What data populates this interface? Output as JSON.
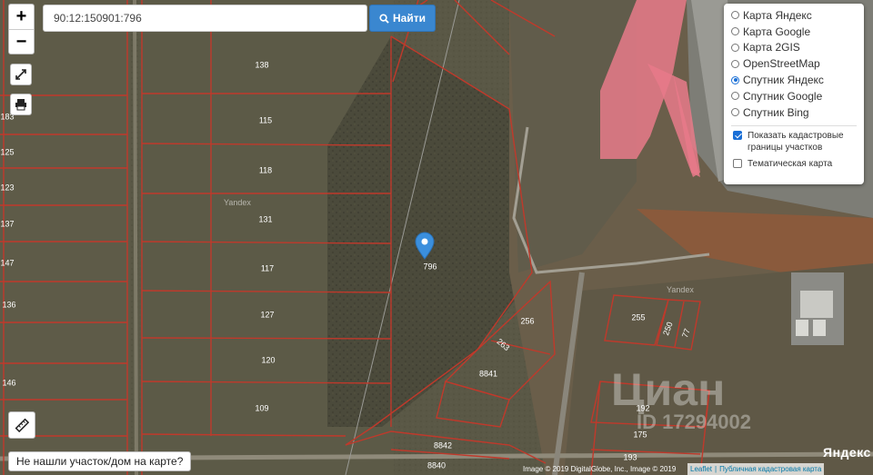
{
  "search": {
    "value": "90:12:150901:796",
    "button_label": "Найти"
  },
  "zoom": {
    "in_label": "+",
    "out_label": "−"
  },
  "layers": {
    "options": [
      {
        "label": "Карта Яндекс",
        "selected": false
      },
      {
        "label": "Карта Google",
        "selected": false
      },
      {
        "label": "Карта 2GIS",
        "selected": false
      },
      {
        "label": "OpenStreetMap",
        "selected": false
      },
      {
        "label": "Спутник Яндекс",
        "selected": true
      },
      {
        "label": "Спутник Google",
        "selected": false
      },
      {
        "label": "Спутник Bing",
        "selected": false
      }
    ],
    "show_boundaries_label": "Показать кадастровые границы участков",
    "show_boundaries_checked": true,
    "thematic_label": "Тематическая карта",
    "thematic_checked": false
  },
  "not_found_button": "Не нашли участок/дом на карте?",
  "attribution": {
    "imagery1": "Image © 2019 DigitalGlobe, Inc., Image © 2019",
    "leaflet": "Leaflet",
    "cadastral": "Публичная кадастровая карта"
  },
  "watermarks": {
    "yandex_logo": "Яндекс",
    "cian": "Циан",
    "cian_id": "ID 17294002",
    "yandex_small": "Yandex"
  },
  "map": {
    "marker_label": "796",
    "parcel_labels": [
      "138",
      "115",
      "118",
      "131",
      "117",
      "127",
      "120",
      "109",
      "183",
      "125",
      "123",
      "137",
      "147",
      "136",
      "146",
      "256",
      "263",
      "8841",
      "255",
      "250",
      "77",
      "192",
      "175",
      "193",
      "8842",
      "8840"
    ],
    "colors": {
      "parcel_border": "#c0392b",
      "highlight_zone": "#e87a8a",
      "marker": "#3b8fdd"
    }
  },
  "icons": {
    "fullscreen": "fullscreen-icon",
    "print": "printer-icon",
    "ruler": "ruler-icon",
    "search": "search-icon",
    "marker": "map-marker-icon"
  }
}
